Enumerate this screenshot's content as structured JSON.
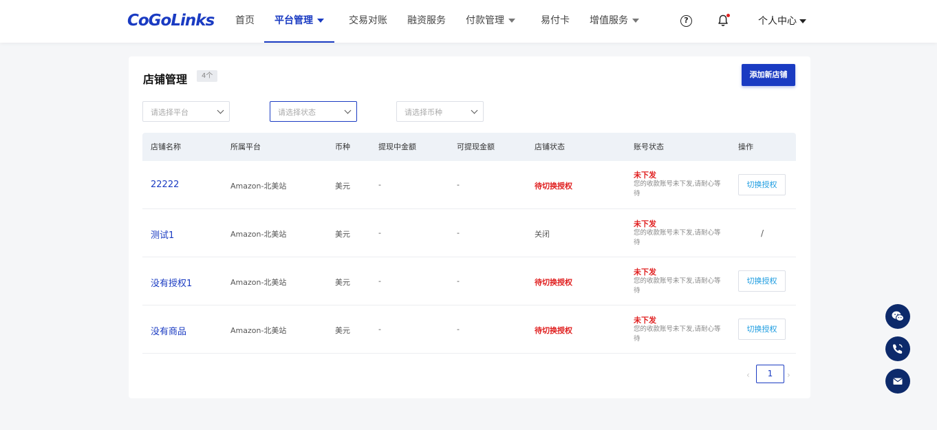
{
  "brand": {
    "logo_text": "CoGoLinks",
    "accent": "#1a3bc2",
    "danger": "#e02020"
  },
  "nav": {
    "items": [
      {
        "label": "首页",
        "dropdown": false,
        "active": false
      },
      {
        "label": "平台管理",
        "dropdown": true,
        "active": true
      },
      {
        "label": "交易对账",
        "dropdown": false,
        "active": false
      },
      {
        "label": "融资服务",
        "dropdown": false,
        "active": false
      },
      {
        "label": "付款管理",
        "dropdown": true,
        "active": false
      },
      {
        "label": "易付卡",
        "dropdown": false,
        "active": false
      },
      {
        "label": "增值服务",
        "dropdown": true,
        "active": false
      }
    ],
    "help_icon": "question-circle-icon",
    "help_glyph": "?",
    "bell_icon": "bell-icon",
    "profile_label": "个人中心"
  },
  "page": {
    "title": "店铺管理",
    "count_badge": "4个",
    "add_button": "添加新店铺"
  },
  "filters": {
    "platform_placeholder": "请选择平台",
    "status_placeholder": "请选择状态",
    "currency_placeholder": "请选择币种"
  },
  "table": {
    "headers": [
      "店铺名称",
      "所属平台",
      "币种",
      "提现中金额",
      "可提现金额",
      "店铺状态",
      "账号状态",
      "操作"
    ],
    "rows": [
      {
        "name": "22222",
        "platform": "Amazon-北美站",
        "currency": "美元",
        "withdrawing": "-",
        "withdrawable": "-",
        "status": "待切换授权",
        "account_status": "未下发",
        "account_desc": "您的收款账号未下发,请耐心等待",
        "action": "切换授权"
      },
      {
        "name": "测试1",
        "platform": "Amazon-北美站",
        "currency": "美元",
        "withdrawing": "-",
        "withdrawable": "-",
        "status": "关闭",
        "account_status": "未下发",
        "account_desc": "您的收款账号未下发,请耐心等待",
        "action": "/"
      },
      {
        "name": "没有授权1",
        "platform": "Amazon-北美站",
        "currency": "美元",
        "withdrawing": "-",
        "withdrawable": "-",
        "status": "待切换授权",
        "account_status": "未下发",
        "account_desc": "您的收款账号未下发,请耐心等待",
        "action": "切换授权"
      },
      {
        "name": "没有商品",
        "platform": "Amazon-北美站",
        "currency": "美元",
        "withdrawing": "-",
        "withdrawable": "-",
        "status": "待切换授权",
        "account_status": "未下发",
        "account_desc": "您的收款账号未下发,请耐心等待",
        "action": "切换授权"
      }
    ]
  },
  "pagination": {
    "prev": "‹",
    "current": "1",
    "next": "›"
  },
  "float_buttons": [
    "wechat-icon",
    "phone-icon",
    "mail-icon"
  ]
}
